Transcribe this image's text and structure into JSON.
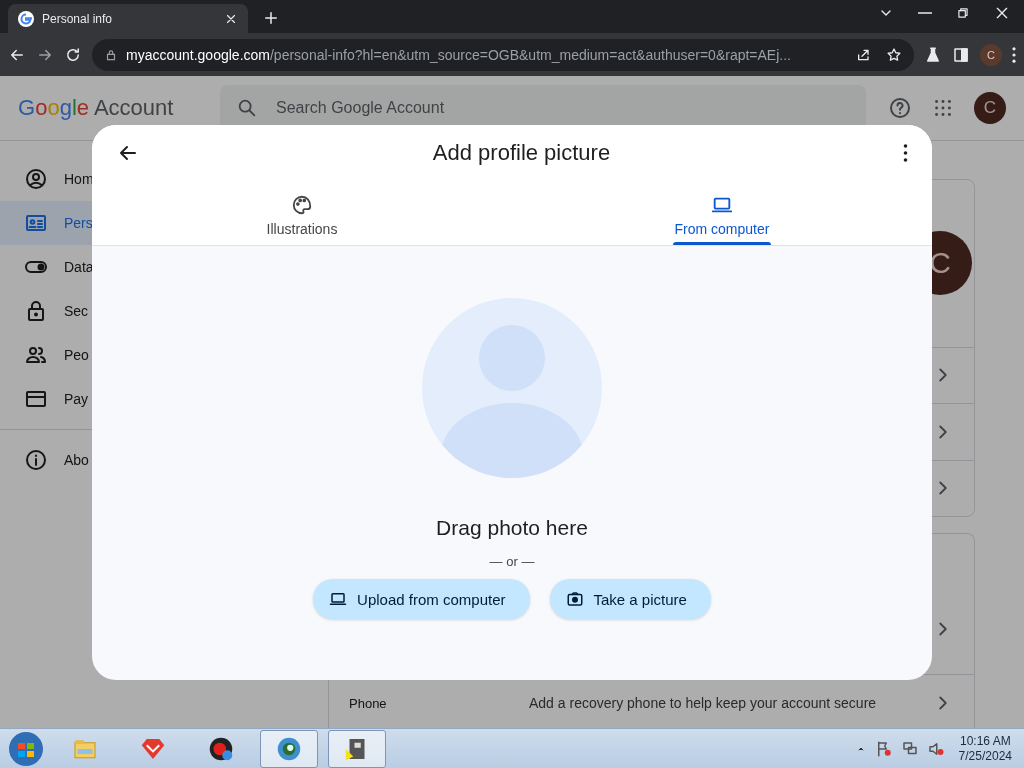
{
  "browser": {
    "tab": {
      "title": "Personal info",
      "selected": true
    },
    "url_host": "myaccount.google.com",
    "url_path": "/personal-info?hl=en&utm_source=OGB&utm_medium=act&authuser=0&rapt=AEj...",
    "profile": "C"
  },
  "header": {
    "logo_word": "Google",
    "logo_suffix": "Account",
    "search_placeholder": "Search Google Account",
    "avatar": "C"
  },
  "sidebar": {
    "items": [
      {
        "label": "Hom",
        "selected": false
      },
      {
        "label": "Pers",
        "selected": true
      },
      {
        "label": "Data",
        "selected": false
      },
      {
        "label": "Sec",
        "selected": false
      },
      {
        "label": "Peo",
        "selected": false
      },
      {
        "label": "Pay",
        "selected": false
      },
      {
        "label": "Abo",
        "selected": false
      }
    ]
  },
  "main": {
    "avatar": "C",
    "phone_row": {
      "label": "Phone",
      "value": "Add a recovery phone to help keep your account secure"
    }
  },
  "dialog": {
    "title": "Add profile picture",
    "tabs": [
      {
        "label": "Illustrations",
        "selected": false
      },
      {
        "label": "From computer",
        "selected": true
      }
    ],
    "drop_text": "Drag photo here",
    "or_text": "— or —",
    "buttons": [
      "Upload from computer",
      "Take a picture"
    ]
  },
  "taskbar": {
    "apps": [
      {
        "active": false
      },
      {
        "active": false
      },
      {
        "active": false
      },
      {
        "active": true
      },
      {
        "active": true
      }
    ],
    "time": "10:16 AM",
    "date": "7/25/2024"
  }
}
